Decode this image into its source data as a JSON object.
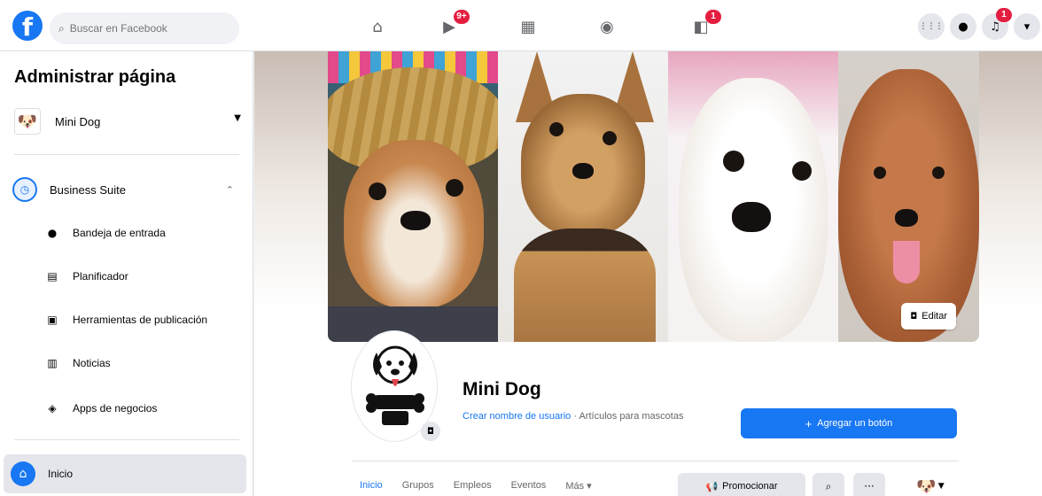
{
  "topbar": {
    "logo_letter": "f",
    "search_placeholder": "Buscar en Facebook",
    "nav": [
      {
        "name": "home",
        "icon": "⌂",
        "badge": ""
      },
      {
        "name": "watch",
        "icon": "▶",
        "badge": "9+"
      },
      {
        "name": "marketplace",
        "icon": "▦",
        "badge": ""
      },
      {
        "name": "groups",
        "icon": "◉",
        "badge": ""
      },
      {
        "name": "gaming",
        "icon": "◧",
        "badge": "1"
      }
    ],
    "right": {
      "menu_icon": "⋮⋮⋮",
      "messenger_icon": "●",
      "notifications_icon": "♫",
      "notifications_badge": "1",
      "account_icon": "▾"
    }
  },
  "sidebar": {
    "title": "Administrar página",
    "page_name": "Mini Dog",
    "suite_label": "Business Suite",
    "items": [
      {
        "label": "Bandeja de entrada",
        "icon": "●"
      },
      {
        "label": "Planificador",
        "icon": "▤"
      },
      {
        "label": "Herramientas de publicación",
        "icon": "▣"
      },
      {
        "label": "Noticias",
        "icon": "▥"
      },
      {
        "label": "Apps de negocios",
        "icon": "◈"
      }
    ],
    "home_label": "Inicio"
  },
  "cover": {
    "edit_label": "Editar"
  },
  "profile": {
    "name": "Mini Dog",
    "username_link": "Crear nombre de usuario",
    "category": " · Artículos para mascotas",
    "add_button": "Agregar un botón"
  },
  "tabs": [
    {
      "label": "Inicio",
      "active": true
    },
    {
      "label": "Grupos",
      "active": false
    },
    {
      "label": "Empleos",
      "active": false
    },
    {
      "label": "Eventos",
      "active": false
    },
    {
      "label": "Más ▾",
      "active": false
    }
  ],
  "actions": {
    "promote_label": "Promocionar",
    "search_icon": "⌕",
    "more_icon": "···"
  },
  "colors": {
    "accent": "#1877f2",
    "badge": "#e41e3f",
    "surface": "#ffffff",
    "background": "#f0f2f5"
  }
}
